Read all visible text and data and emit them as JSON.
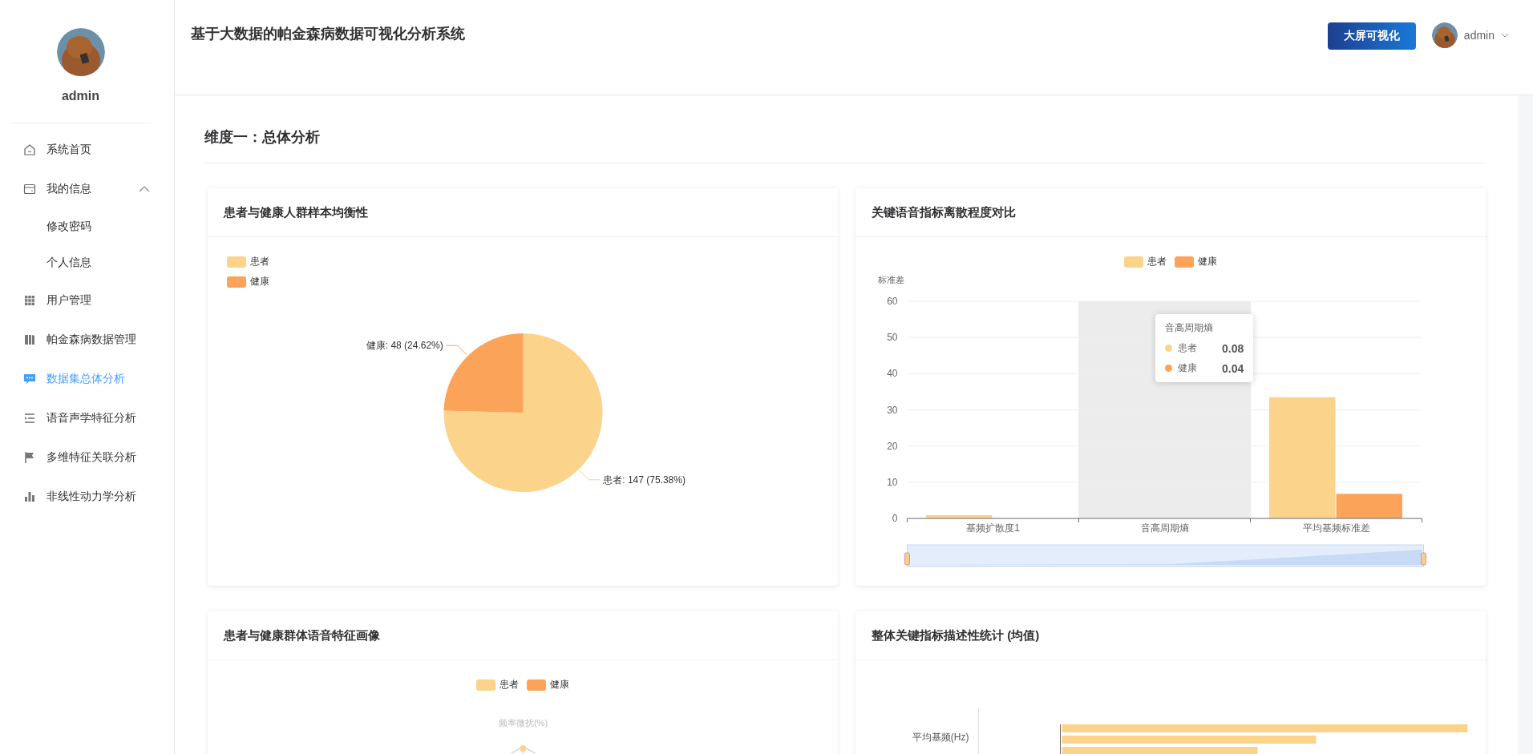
{
  "sidebar": {
    "user": {
      "name": "admin"
    },
    "items": [
      {
        "label": "系统首页",
        "selected": false
      },
      {
        "label": "我的信息",
        "selected": false,
        "expanded": true,
        "children": [
          {
            "label": "修改密码",
            "selected": false
          },
          {
            "label": "个人信息",
            "selected": false
          }
        ]
      },
      {
        "label": "用户管理",
        "selected": false
      },
      {
        "label": "帕金森病数据管理",
        "selected": false
      },
      {
        "label": "数据集总体分析",
        "selected": true
      },
      {
        "label": "语音声学特征分析",
        "selected": false
      },
      {
        "label": "多维特征关联分析",
        "selected": false
      },
      {
        "label": "非线性动力学分析",
        "selected": false
      }
    ]
  },
  "header": {
    "title": "基于大数据的帕金森病数据可视化分析系统",
    "button": "大屏可视化",
    "user": "admin"
  },
  "section_title": "维度一：总体分析",
  "cards": [
    {
      "kind": "pie",
      "title": "患者与健康人群样本均衡性",
      "slice_colors": [
        {
          "color": "#fcd38a"
        },
        {
          "color": "#fca35a"
        }
      ],
      "chart_data": {
        "type": "pie",
        "categories": [
          "患者",
          "健康"
        ],
        "values": [
          147,
          48
        ],
        "value_labels": [
          "患者: 147 (75.38%)",
          "健康: 48 (24.62%)"
        ]
      }
    },
    {
      "kind": "bar",
      "title": "关键语音指标离散程度对比",
      "chart_data": {
        "type": "bar",
        "ylabel": "标准差",
        "categories": [
          "基频扩散度1",
          "音高周期熵",
          "平均基频标准差"
        ],
        "series": [
          {
            "name": "患者",
            "color": "#fcd38a",
            "values": [
              0.9,
              null,
              33.5
            ]
          },
          {
            "name": "健康",
            "color": "#fca35a",
            "values": [
              null,
              null,
              6.8
            ]
          }
        ],
        "ylim": [
          0,
          60
        ],
        "yticks": [
          0,
          10,
          20,
          30,
          40,
          50,
          60
        ],
        "grid": true
      },
      "highlighted": [
        false,
        true,
        false
      ],
      "tooltip": {
        "title": "音高周期熵",
        "rows": [
          {
            "label": "患者",
            "value": "0.08",
            "color": "#fcd38a"
          },
          {
            "label": "健康",
            "value": "0.04",
            "color": "#fca35a"
          }
        ]
      }
    },
    {
      "kind": "radar",
      "title": "患者与健康群体语音特征画像",
      "legend": [
        {
          "label": "患者",
          "color": "#fcd38a"
        },
        {
          "label": "健康",
          "color": "#fca35a"
        }
      ],
      "axis_labels": [
        "频率微扰(%)"
      ]
    },
    {
      "kind": "hbar",
      "title": "整体关键指标描述性统计 (均值)",
      "category_labels": [
        "平均基频(Hz)"
      ]
    }
  ]
}
